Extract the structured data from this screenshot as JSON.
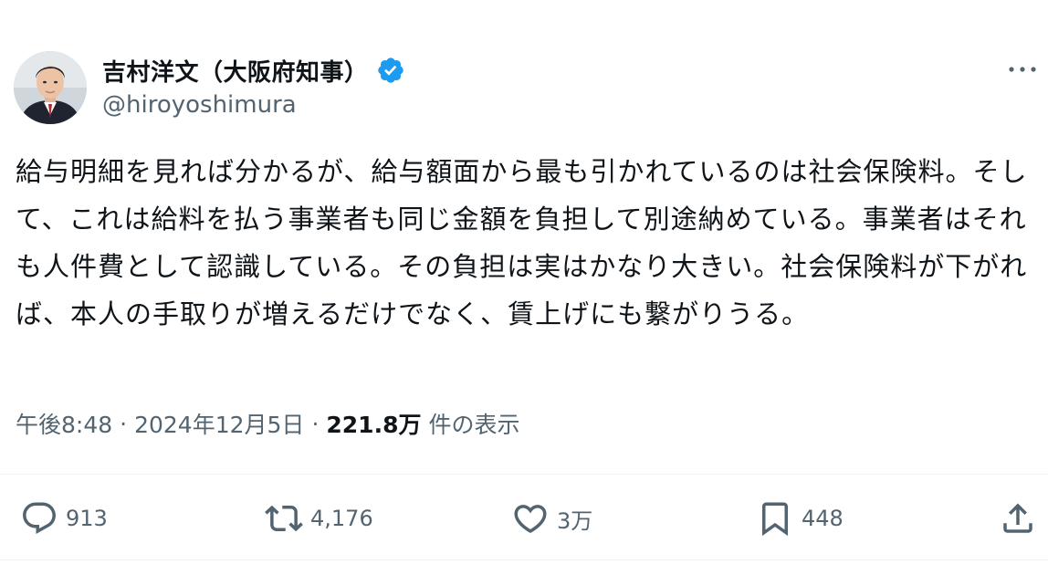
{
  "author": {
    "display_name": "吉村洋文（大阪府知事）",
    "handle": "@hiroyoshimura",
    "verified": true,
    "verified_color": "#1d9bf0"
  },
  "tweet": {
    "text": "給与明細を見れば分かるが、給与額面から最も引かれているのは社会保険料。そして、これは給料を払う事業者も同じ金額を負担して別途納めている。事業者はそれも人件費として認識している。その負担は実はかなり大きい。社会保険料が下がれば、本人の手取りが増えるだけでなく、賃上げにも繋がりうる。",
    "time": "午後8:48",
    "separator": "·",
    "date": "2024年12月5日",
    "views_count": "221.8万",
    "views_label": "件の表示"
  },
  "actions": {
    "reply": {
      "icon": "reply-icon",
      "count": "913"
    },
    "retweet": {
      "icon": "retweet-icon",
      "count": "4,176"
    },
    "like": {
      "icon": "heart-icon",
      "count": "3万"
    },
    "bookmark": {
      "icon": "bookmark-icon",
      "count": "448"
    },
    "share": {
      "icon": "share-icon"
    }
  },
  "colors": {
    "text_primary": "#0f1419",
    "text_secondary": "#536471",
    "divider": "#eff3f4"
  }
}
